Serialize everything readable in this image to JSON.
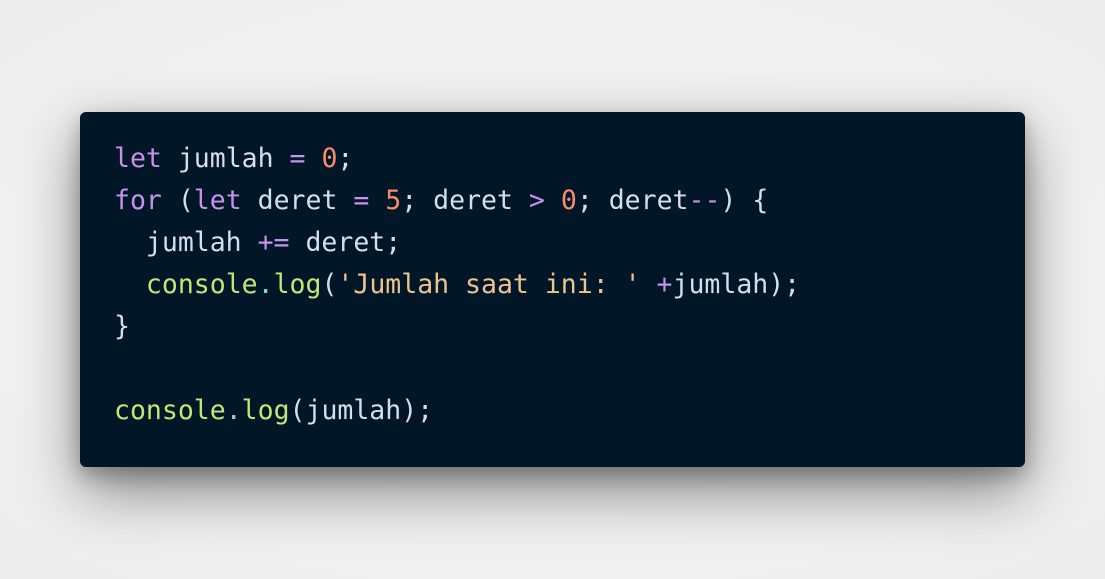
{
  "code_lines": [
    [
      {
        "t": "let",
        "c": "kw"
      },
      {
        "t": " jumlah ",
        "c": "id"
      },
      {
        "t": "=",
        "c": "op"
      },
      {
        "t": " ",
        "c": "id"
      },
      {
        "t": "0",
        "c": "num"
      },
      {
        "t": ";",
        "c": "punc"
      }
    ],
    [
      {
        "t": "for",
        "c": "kw"
      },
      {
        "t": " (",
        "c": "punc"
      },
      {
        "t": "let",
        "c": "kw"
      },
      {
        "t": " deret ",
        "c": "id"
      },
      {
        "t": "=",
        "c": "op"
      },
      {
        "t": " ",
        "c": "id"
      },
      {
        "t": "5",
        "c": "num"
      },
      {
        "t": "; deret ",
        "c": "id"
      },
      {
        "t": ">",
        "c": "op"
      },
      {
        "t": " ",
        "c": "id"
      },
      {
        "t": "0",
        "c": "num"
      },
      {
        "t": "; deret",
        "c": "id"
      },
      {
        "t": "--",
        "c": "op"
      },
      {
        "t": ") {",
        "c": "punc"
      }
    ],
    [
      {
        "t": "  jumlah ",
        "c": "id"
      },
      {
        "t": "+=",
        "c": "op"
      },
      {
        "t": " deret;",
        "c": "id"
      }
    ],
    [
      {
        "t": "  ",
        "c": "id"
      },
      {
        "t": "console",
        "c": "fn"
      },
      {
        "t": ".",
        "c": "dot"
      },
      {
        "t": "log",
        "c": "fn"
      },
      {
        "t": "(",
        "c": "punc"
      },
      {
        "t": "'Jumlah saat ini: '",
        "c": "str"
      },
      {
        "t": " ",
        "c": "id"
      },
      {
        "t": "+",
        "c": "op"
      },
      {
        "t": "jumlah);",
        "c": "id"
      }
    ],
    [
      {
        "t": "}",
        "c": "punc"
      }
    ],
    [],
    [
      {
        "t": "console",
        "c": "fn"
      },
      {
        "t": ".",
        "c": "dot"
      },
      {
        "t": "log",
        "c": "fn"
      },
      {
        "t": "(jumlah);",
        "c": "id"
      }
    ]
  ],
  "theme": {
    "background": "#011627",
    "keyword": "#c792ea",
    "number": "#f78c6c",
    "function": "#c5e478",
    "string": "#ecc48d",
    "text": "#d6deeb"
  }
}
